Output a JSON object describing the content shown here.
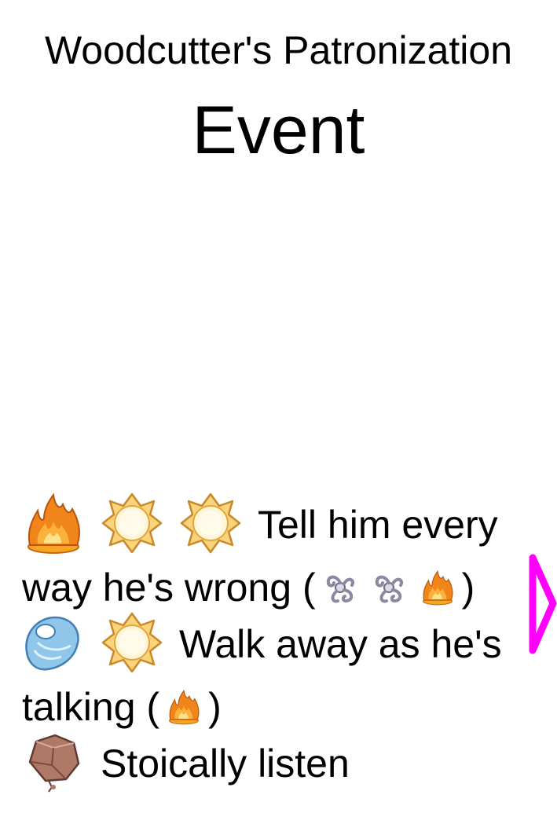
{
  "event": {
    "title": "Woodcutter's Patronization",
    "heading": "Event"
  },
  "choices": [
    {
      "costs": [
        "fire-icon",
        "sun-icon",
        "sun-icon"
      ],
      "text": "Tell him every way he's wrong",
      "effects": [
        "wind-icon",
        "wind-icon",
        "fire-icon"
      ]
    },
    {
      "costs": [
        "water-icon",
        "sun-icon"
      ],
      "text": "Walk away as he's talking",
      "effects": [
        "fire-icon"
      ]
    },
    {
      "costs": [
        "earth-icon"
      ],
      "text": "Stoically listen",
      "effects": []
    }
  ],
  "colors": {
    "next_arrow": "#ff00ff",
    "fire": "#f0861a",
    "sun": "#f7c04a",
    "wind": "#8c88a2",
    "water": "#8fc6ea",
    "earth": "#b07867"
  },
  "nav": {
    "next_icon": "arrow-right-outline-icon"
  }
}
